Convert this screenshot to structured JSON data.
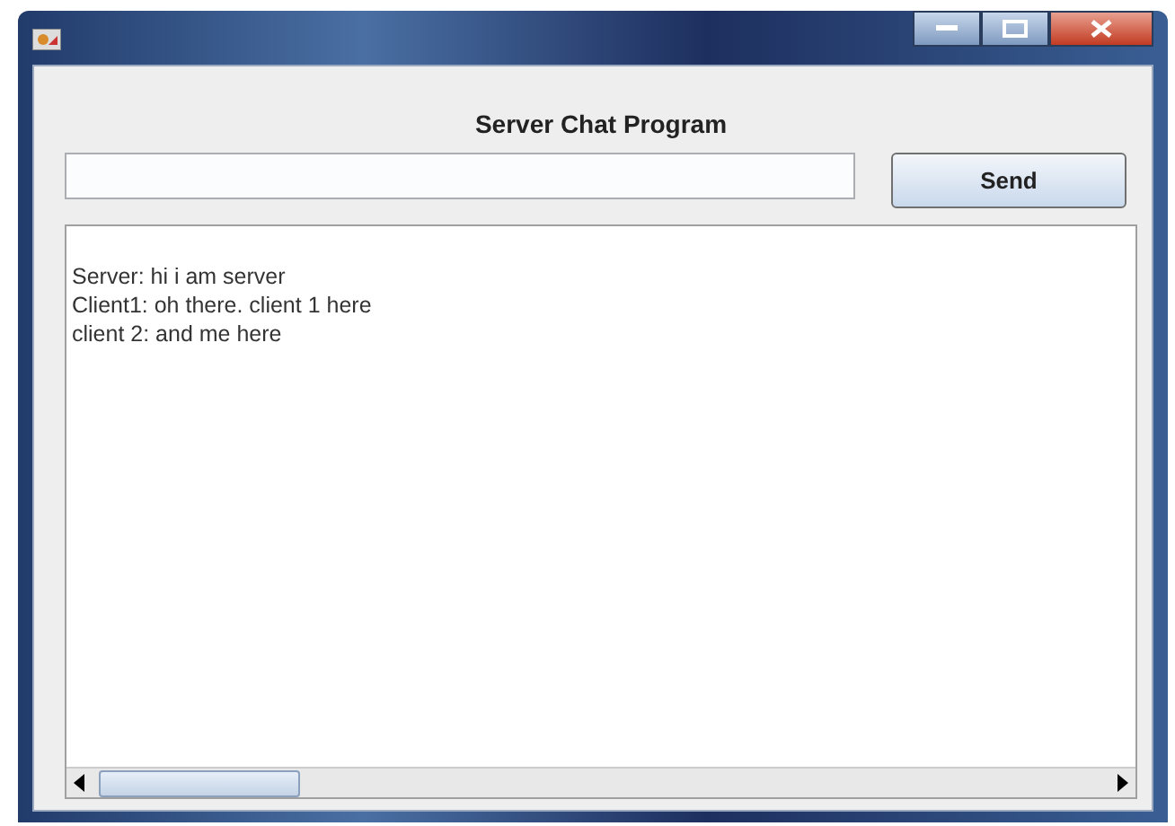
{
  "heading": "Server Chat Program",
  "send_button": "Send",
  "chat_lines": [
    "Server: hi i am server",
    "Client1: oh there. client 1 here",
    "client 2: and me here"
  ]
}
